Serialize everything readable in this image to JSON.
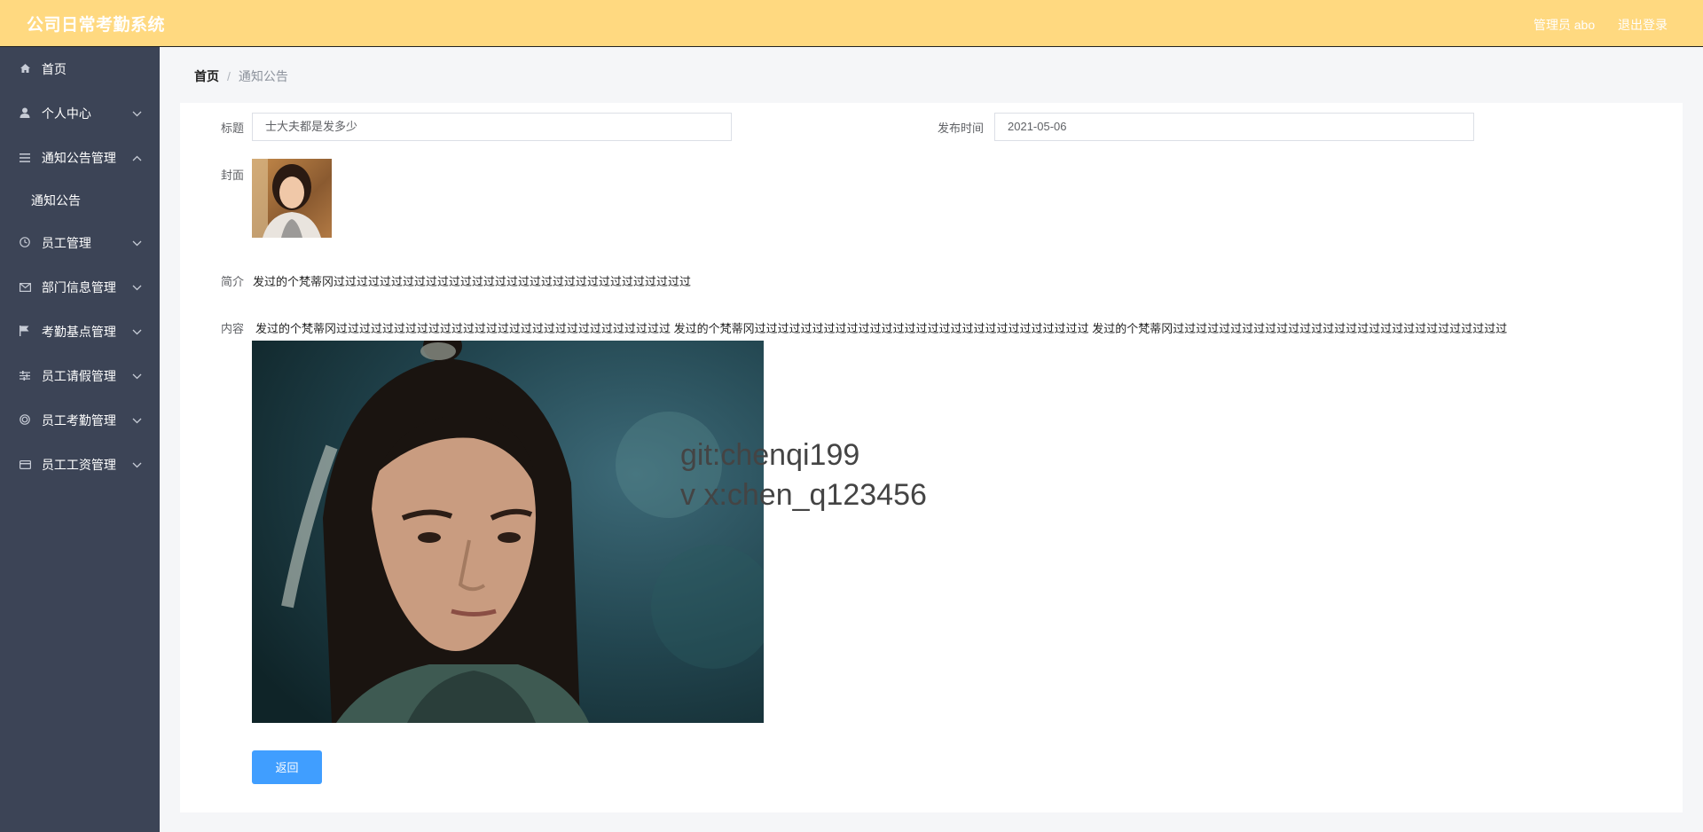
{
  "header": {
    "app_title": "公司日常考勤系统",
    "user_label": "管理员 abo",
    "logout_label": "退出登录"
  },
  "sidebar": {
    "items": [
      {
        "label": "首页",
        "icon": "home-icon"
      },
      {
        "label": "个人中心",
        "icon": "user-icon"
      },
      {
        "label": "通知公告管理",
        "icon": "menu-icon"
      },
      {
        "label": "员工管理",
        "icon": "clock-icon"
      },
      {
        "label": "部门信息管理",
        "icon": "mail-icon"
      },
      {
        "label": "考勤基点管理",
        "icon": "flag-icon"
      },
      {
        "label": "员工请假管理",
        "icon": "sliders-icon"
      },
      {
        "label": "员工考勤管理",
        "icon": "target-icon"
      },
      {
        "label": "员工工资管理",
        "icon": "card-icon"
      }
    ],
    "sub_items": {
      "notice": "通知公告"
    }
  },
  "breadcrumb": {
    "home": "首页",
    "separator": "/",
    "current": "通知公告"
  },
  "form": {
    "title_label": "标题",
    "title_value": "士大夫都是发多少",
    "publish_time_label": "发布时间",
    "publish_time_value": "2021-05-06",
    "cover_label": "封面",
    "intro_label": "简介",
    "intro_value": "发过的个梵蒂冈过过过过过过过过过过过过过过过过过过过过过过过过过过过过过过过",
    "content_label": "内容",
    "content_value": "发过的个梵蒂冈过过过过过过过过过过过过过过过过过过过过过过过过过过过过过 发过的个梵蒂冈过过过过过过过过过过过过过过过过过过过过过过过过过过过过过 发过的个梵蒂冈过过过过过过过过过过过过过过过过过过过过过过过过过过过过过",
    "back_label": "返回"
  },
  "watermark": {
    "line1": "git:chenqi199",
    "line2": "v x:chen_q123456"
  },
  "colors": {
    "header_bg": "#ffd980",
    "sidebar_bg": "#3c4456",
    "primary": "#409eff"
  }
}
